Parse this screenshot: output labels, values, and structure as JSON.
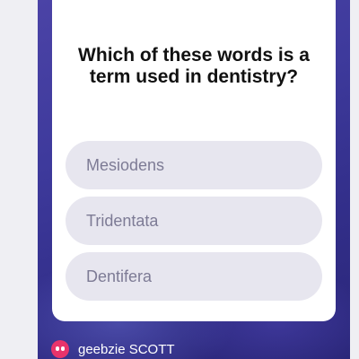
{
  "quiz": {
    "question": "Which of these words is a term used in dentistry?",
    "options": [
      "Mesiodens",
      "Tridentata",
      "Dentifera"
    ]
  },
  "footer": {
    "brand": "geebzie",
    "partner": "SCOTT",
    "logo_icon": "geebzie-logo-icon"
  },
  "colors": {
    "background_outer": "#efeff3",
    "frame_purple": "#3e3a9c",
    "card": "#ffffff",
    "option_bg": "#e7e6ef",
    "option_text": "#7d7b95",
    "logo_pink": "#e8336b"
  }
}
